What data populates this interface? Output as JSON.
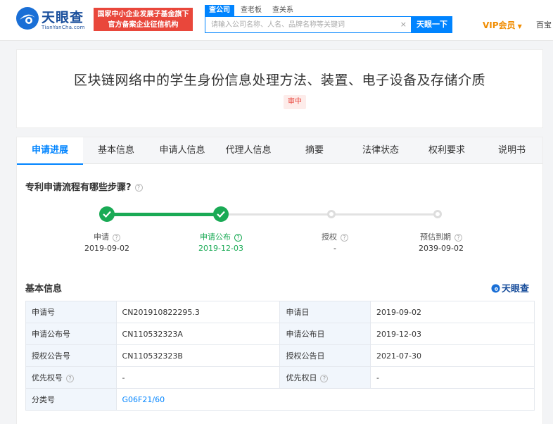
{
  "header": {
    "logo_text": "天眼查",
    "logo_sub": "TianYanCha.com",
    "badge_line1": "国家中小企业发展子基金旗下",
    "badge_line2": "官方备案企业征信机构",
    "search_tabs": [
      "查公司",
      "查老板",
      "查关系"
    ],
    "search_placeholder": "请输入公司名称、人名、品牌名称等关键词",
    "search_clear": "×",
    "search_button": "天眼一下",
    "vip_label": "VIP会员",
    "extra_label": "百宝"
  },
  "patent": {
    "title": "区块链网络中的学生身份信息处理方法、装置、电子设备及存储介质",
    "status": "审中"
  },
  "tabs": [
    "申请进展",
    "基本信息",
    "申请人信息",
    "代理人信息",
    "摘要",
    "法律状态",
    "权利要求",
    "说明书"
  ],
  "process": {
    "question": "专利申请流程有哪些步骤?",
    "steps": [
      {
        "label": "申请",
        "date": "2019-09-02",
        "done": true
      },
      {
        "label": "申请公布",
        "date": "2019-12-03",
        "done": true
      },
      {
        "label": "授权",
        "date": "-",
        "done": false
      },
      {
        "label": "预估到期",
        "date": "2039-09-02",
        "done": false
      }
    ]
  },
  "basic": {
    "title": "基本信息",
    "watermark": "天眼查",
    "rows": [
      {
        "k1": "申请号",
        "v1": "CN201910822295.3",
        "k2": "申请日",
        "v2": "2019-09-02"
      },
      {
        "k1": "申请公布号",
        "v1": "CN110532323A",
        "k2": "申请公布日",
        "v2": "2019-12-03"
      },
      {
        "k1": "授权公告号",
        "v1": "CN110532323B",
        "k2": "授权公告日",
        "v2": "2021-07-30"
      },
      {
        "k1": "优先权号",
        "v1": "-",
        "k2": "优先权日",
        "v2": "-"
      }
    ],
    "classification_label": "分类号",
    "classification_value": "G06F21/60"
  },
  "colors": {
    "brand": "#0084ff",
    "done": "#1aaa55",
    "vip": "#f08c00",
    "badge": "#e9473b"
  }
}
